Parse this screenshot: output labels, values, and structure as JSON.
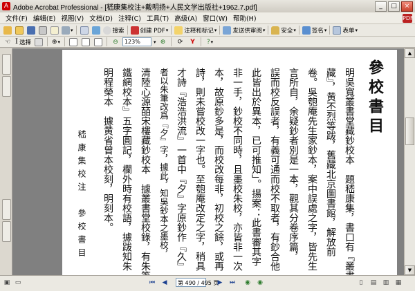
{
  "window": {
    "title": "Adobe Acrobat Professional - [嵇康集校注+戴明扬+人民文学出版社+1962.7.pdf]"
  },
  "menus": [
    "文件(F)",
    "编辑(E)",
    "视图(V)",
    "文档(D)",
    "注释(C)",
    "工具(T)",
    "高级(A)",
    "窗口(W)",
    "帮助(H)"
  ],
  "toolbar": {
    "buttons": [
      "创建 PDF",
      "注释和标记",
      "发送供审阅",
      "安全",
      "签名",
      "表单"
    ],
    "search_label": "搜索",
    "select_label": "选择"
  },
  "zoom": {
    "value": "123%"
  },
  "navigation": {
    "current_page": "第 490 / 495 页",
    "total_label": ""
  },
  "page": {
    "heading": "參校書目",
    "side_footer": "嵇康集校注　參校書目",
    "columns": [
      "明吳寬叢書堂藏鈔校本　題嵇康集，書口有『叢書",
      "藏』，黄丕烈等跋，舊藏北京圖書館，解放前",
      "卷。吳匏庵先生家鈔本，案中誤處之字，皆先生",
      "言所自，余疑鈔者別是一本，觀其分卷序篇，",
      "誤而校反誤者，有義可通而校不取者，有鈔合他",
      "此皆出於異本，已可推知」。揚案：此書審其字",
      "非一手，鈔校不同時，且墨校朱校，亦皆非一次",
      "本，故原鈔多是，而校改每非，初校之餘，或再",
      "詩，則未嘗校改一字也。至匏庵改定之字，稍具",
      "才詩『浩浩洪流』一首中『夕』字原鈔作『久』",
      "者以朱筆改爲『夕』字，據此，知吳鈔本之墨校，",
      "清陸心源皕宋樓藏鈔校本　據叢書堂校錄，有朱筆",
      "鐵網校本』五字圓記，欄外時有校語，據跋知朱",
      "明程榮本　據黄省曾本校刻，明刻本。"
    ]
  }
}
